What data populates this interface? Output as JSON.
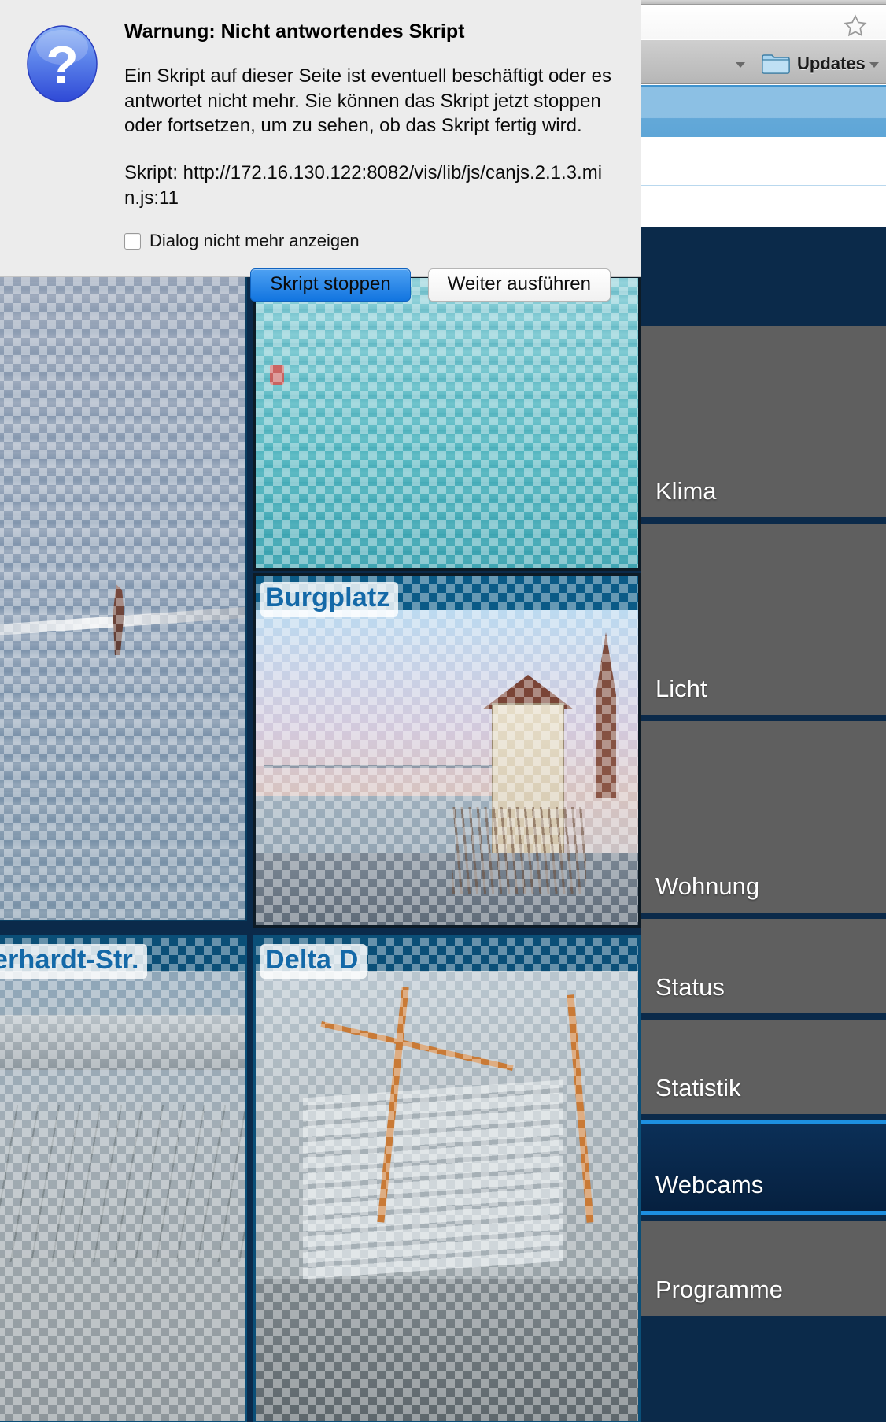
{
  "browser": {
    "star_icon": "bookmark-star-icon",
    "bookmark_folder_icon": "folder-icon",
    "bookmark_folder_label": "Updates",
    "overflow_caret_left": "chevron-down-icon",
    "overflow_caret_right": "chevron-down-icon"
  },
  "dialog": {
    "icon": "question-mark-icon",
    "title": "Warnung: Nicht antwortendes Skript",
    "message": "Ein Skript auf dieser Seite ist eventuell beschäftigt oder es antwortet nicht mehr. Sie können das Skript jetzt stoppen oder fortsetzen, um zu sehen, ob das Skript fertig wird.",
    "script_line": "Skript: http://172.16.130.122:8082/vis/lib/js/canjs.2.1.3.min.js:11",
    "checkbox_label": "Dialog nicht mehr anzeigen",
    "checkbox_checked": false,
    "primary_button": "Skript stoppen",
    "secondary_button": "Weiter ausführen",
    "accent_color": "#1275e0",
    "background_color": "#ececec"
  },
  "webcams": [
    {
      "id": "altstadt",
      "title": ""
    },
    {
      "id": "rathaus",
      "title": ""
    },
    {
      "id": "burgplatz",
      "title": "Burgplatz"
    },
    {
      "id": "erhardt",
      "title": "erhardt-Str."
    },
    {
      "id": "delta",
      "title": "Delta D"
    }
  ],
  "sidebar": {
    "active_item": "Webcams",
    "active_color": "#1d8fe0",
    "item_color": "#5f5f5f",
    "background_color": "#0b2a4a",
    "items": [
      {
        "label": "Klima",
        "active": false
      },
      {
        "label": "Licht",
        "active": false
      },
      {
        "label": "Wohnung",
        "active": false
      },
      {
        "label": "Status",
        "active": false
      },
      {
        "label": "Statistik",
        "active": false
      },
      {
        "label": "Webcams",
        "active": true
      },
      {
        "label": "Programme",
        "active": false
      }
    ]
  }
}
